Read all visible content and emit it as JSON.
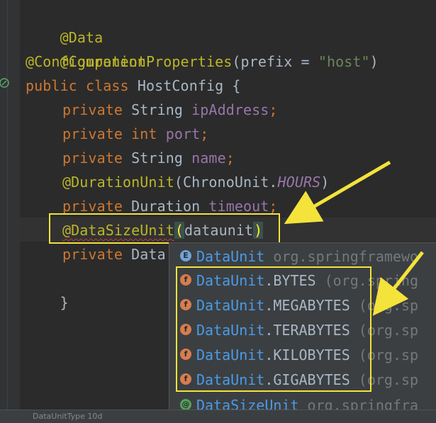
{
  "code": {
    "l1": "@Data",
    "l2": "@Component",
    "l3_ann": "@ConfigurationProperties",
    "l3_open": "(prefix = ",
    "l3_str": "\"host\"",
    "l3_close": ")",
    "l4_kw": "public class ",
    "l4_name": "HostConfig {",
    "l5_kw": "private ",
    "l5_type": "String ",
    "l5_field": "ipAddress",
    "l5_semi": ";",
    "l6_kw": "private int ",
    "l6_field": "port",
    "l6_semi": ";",
    "l7_kw": "private ",
    "l7_type": "String ",
    "l7_field": "name",
    "l7_semi": ";",
    "l8_ann": "@DurationUnit",
    "l8_open": "(ChronoUnit.",
    "l8_const": "HOURS",
    "l8_close": ")",
    "l9_kw": "private ",
    "l9_type": "Duration ",
    "l9_field": "timeout",
    "l9_semi": ";",
    "l10_ann": "@DataSizeUnit",
    "l10_open": "(",
    "l10_arg": "dataunit",
    "l10_close": ")",
    "l11_kw": "private ",
    "l11_type": "Data",
    "l12": "}"
  },
  "completion": {
    "items": [
      {
        "icon": "E",
        "name": "DataUnit",
        "member": "",
        "pkg": " org.springframewo"
      },
      {
        "icon": "f",
        "name": "DataUnit",
        "member": ".BYTES",
        "pkg": "  (org.spring"
      },
      {
        "icon": "f",
        "name": "DataUnit",
        "member": ".MEGABYTES",
        "pkg": " (org.sp"
      },
      {
        "icon": "f",
        "name": "DataUnit",
        "member": ".TERABYTES",
        "pkg": " (org.sp"
      },
      {
        "icon": "f",
        "name": "DataUnit",
        "member": ".KILOBYTES",
        "pkg": " (org.sp"
      },
      {
        "icon": "f",
        "name": "DataUnit",
        "member": ".GIGABYTES",
        "pkg": " (org.sp"
      },
      {
        "icon": "@",
        "name": "DataSize",
        "member": "Unit",
        "pkg": " org.springfra"
      }
    ]
  },
  "status": {
    "text": "DataUnitType  10d"
  },
  "colors": {
    "annotation": "#f3e33a",
    "background": "#2b2b2b",
    "popup": "#3c3f41",
    "link": "#4a9be8"
  }
}
